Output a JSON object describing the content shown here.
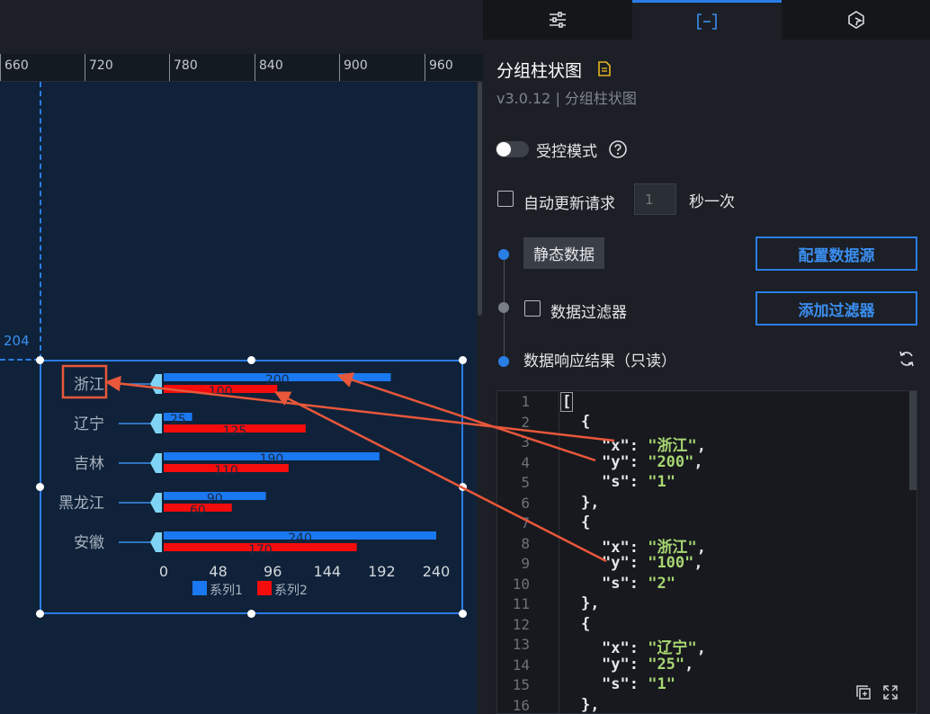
{
  "ruler": {
    "labels": [
      "660",
      "720",
      "780",
      "840",
      "900",
      "960"
    ]
  },
  "guide": {
    "value": "204"
  },
  "chart_data": {
    "type": "bar",
    "orientation": "horizontal",
    "categories": [
      "浙江",
      "辽宁",
      "吉林",
      "黑龙江",
      "安徽"
    ],
    "series": [
      {
        "name": "系列1",
        "values": [
          200,
          25,
          190,
          90,
          240
        ],
        "color": "#1a78f0"
      },
      {
        "name": "系列2",
        "values": [
          100,
          125,
          110,
          60,
          170
        ],
        "color": "#f50c0c"
      }
    ],
    "xticks": [
      "0",
      "48",
      "96",
      "144",
      "192",
      "240"
    ],
    "xlim": [
      0,
      240
    ],
    "grid": false,
    "legend": "bottom-center",
    "highlight_category": "浙江"
  },
  "tabs": [
    {
      "name": "config-tab",
      "icon": "sliders-icon"
    },
    {
      "name": "data-tab",
      "icon": "data-bracket-icon"
    },
    {
      "name": "interaction-tab",
      "icon": "pointer-icon"
    }
  ],
  "panel": {
    "title": "分组柱状图",
    "version": "v3.0.12 | 分组柱状图",
    "controlled_mode": "受控模式",
    "auto_update": "自动更新请求",
    "interval_placeholder": "1",
    "interval_unit": "秒一次",
    "static_data": "静态数据",
    "config_source": "配置数据源",
    "data_filter": "数据过滤器",
    "add_filter": "添加过滤器",
    "response_result": "数据响应结果（只读）"
  },
  "editor": {
    "line_numbers": [
      "1",
      "2",
      "3",
      "4",
      "5",
      "6",
      "7",
      "8",
      "9",
      "10",
      "11",
      "12",
      "13",
      "14",
      "15",
      "16"
    ],
    "items": [
      {
        "x": "浙江",
        "y": "200",
        "s": "1"
      },
      {
        "x": "浙江",
        "y": "100",
        "s": "2"
      },
      {
        "x": "辽宁",
        "y": "25",
        "s": "1"
      }
    ]
  },
  "colors": {
    "accent": "#2b7de6",
    "annotation": "#e8573a",
    "series1": "#1a78f0",
    "series2": "#f50c0c",
    "json_string": "#a8d672"
  }
}
